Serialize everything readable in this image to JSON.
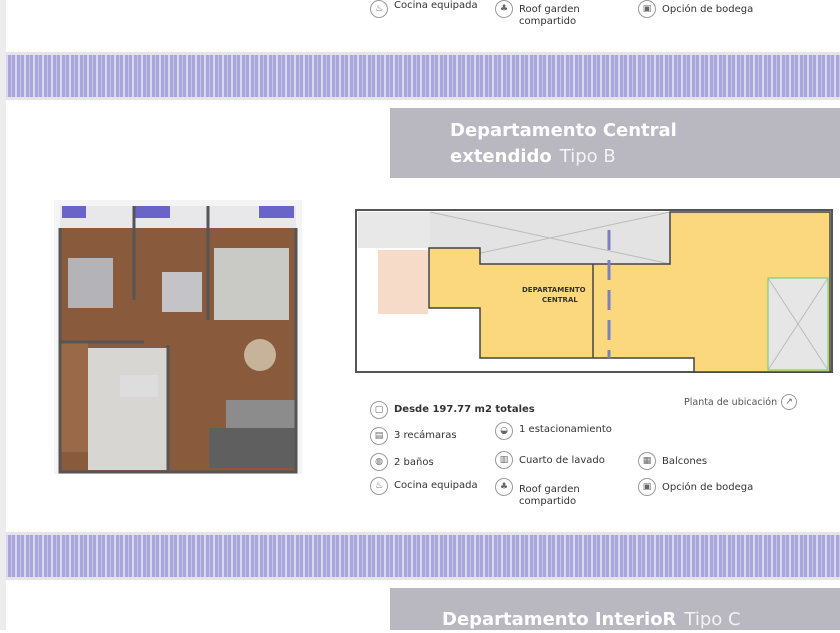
{
  "top_features": [
    {
      "icon": "kitchen-icon",
      "label": "Cocina equipada"
    },
    {
      "icon": "garden-icon",
      "label": "Roof garden",
      "label2": "compartido"
    },
    {
      "icon": "storage-icon",
      "label": "Opción de bodega"
    }
  ],
  "unit_b": {
    "title_line1": "Departamento Central",
    "title_line2": "extendido",
    "type": "Tipo B",
    "area": "Desde 197.77 m2 totales",
    "location_label": "Planta de ubicación",
    "location_plan_label1": "DEPARTAMENTO",
    "location_plan_label2": "CENTRAL",
    "features": [
      {
        "icon": "bed-icon",
        "label": "3 recámaras"
      },
      {
        "icon": "car-icon",
        "label": "1 estacionamiento"
      },
      {
        "icon": "toilet-icon",
        "label": "2  baños"
      },
      {
        "icon": "washer-icon",
        "label": "Cuarto de lavado"
      },
      {
        "icon": "balcony-icon",
        "label": "Balcones"
      },
      {
        "icon": "kitchen-icon",
        "label": "Cocina equipada"
      },
      {
        "icon": "garden-icon",
        "label": "Roof garden",
        "label2": "compartido"
      },
      {
        "icon": "storage-icon",
        "label": "Opción de bodega"
      }
    ]
  },
  "unit_c": {
    "title": "Departamento InterioR",
    "type": "Tipo C"
  },
  "colors": {
    "band": "#a9a6dc",
    "titlebar": "#b9b7c0",
    "plan_fill": "#fbd77e"
  }
}
